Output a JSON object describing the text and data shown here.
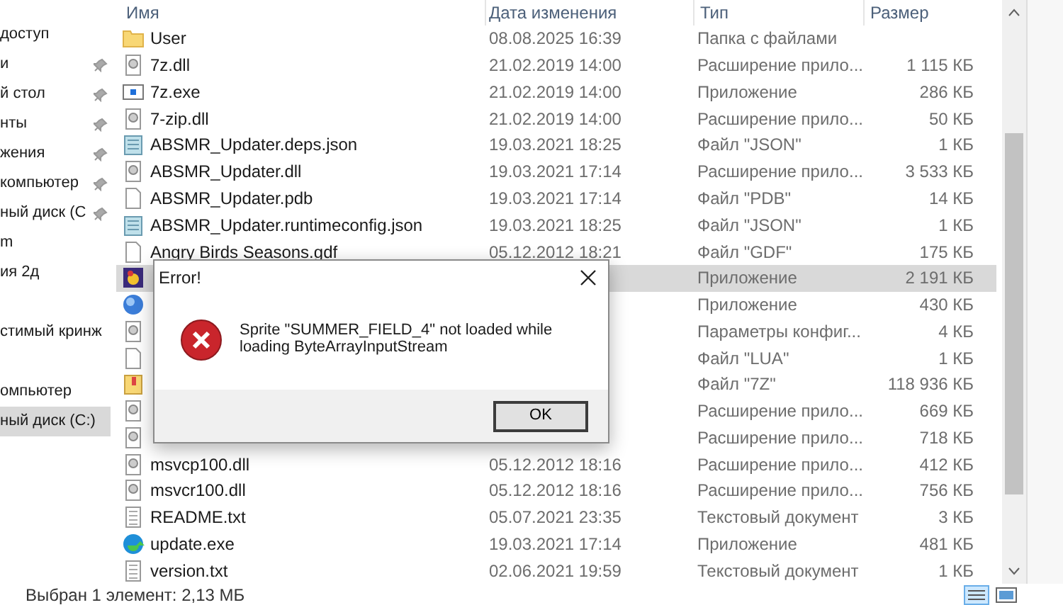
{
  "nav_groups": [
    {
      "items": [
        {
          "label": "доступ",
          "pinned": false,
          "selected": false
        },
        {
          "label": "и",
          "pinned": true,
          "selected": false
        },
        {
          "label": "й стол",
          "pinned": true,
          "selected": false
        },
        {
          "label": "нты",
          "pinned": true,
          "selected": false
        },
        {
          "label": "жения",
          "pinned": true,
          "selected": false
        },
        {
          "label": "компьютер",
          "pinned": true,
          "selected": false
        },
        {
          "label": "ный диск (C",
          "pinned": true,
          "selected": false
        },
        {
          "label": "m",
          "pinned": false,
          "selected": false
        },
        {
          "label": "ия 2д",
          "pinned": false,
          "selected": false
        }
      ]
    },
    {
      "items": [
        {
          "label": "стимый кринж",
          "pinned": false,
          "selected": false
        }
      ]
    },
    {
      "items": [
        {
          "label": "омпьютер",
          "pinned": false,
          "selected": false
        },
        {
          "label": "ный диск (C:)",
          "pinned": false,
          "selected": true
        }
      ]
    }
  ],
  "columns": [
    "Имя",
    "Дата изменения",
    "Тип",
    "Размер"
  ],
  "files": [
    {
      "kind": "folder",
      "name": "User",
      "date": "08.08.2025 16:39",
      "type": "Папка с файлами",
      "selected": false
    },
    {
      "kind": "dll",
      "name": "7z.dll",
      "date": "21.02.2019 14:00",
      "type": "Расширение прило...",
      "size": "1 115 КБ",
      "selected": false
    },
    {
      "kind": "exe",
      "name": "7z.exe",
      "date": "21.02.2019 14:00",
      "type": "Приложение",
      "size": "286 КБ",
      "selected": false
    },
    {
      "kind": "dll",
      "name": "7-zip.dll",
      "date": "21.02.2019 14:00",
      "type": "Расширение прило...",
      "size": "50 КБ",
      "selected": false
    },
    {
      "kind": "json",
      "name": "ABSMR_Updater.deps.json",
      "date": "19.03.2021 18:25",
      "type": "Файл \"JSON\"",
      "size": "1 КБ",
      "selected": false
    },
    {
      "kind": "dll",
      "name": "ABSMR_Updater.dll",
      "date": "19.03.2021 17:14",
      "type": "Расширение прило...",
      "size": "3 533 КБ",
      "selected": false
    },
    {
      "kind": "file",
      "name": "ABSMR_Updater.pdb",
      "date": "19.03.2021 17:14",
      "type": "Файл \"PDB\"",
      "size": "14 КБ",
      "selected": false
    },
    {
      "kind": "json",
      "name": "ABSMR_Updater.runtimeconfig.json",
      "date": "19.03.2021 18:25",
      "type": "Файл \"JSON\"",
      "size": "1 КБ",
      "selected": false
    },
    {
      "kind": "file",
      "name": "Angry Birds Seasons.gdf",
      "date": "05.12.2012 18:21",
      "type": "Файл \"GDF\"",
      "size": "175 КБ",
      "selected": false
    },
    {
      "kind": "game",
      "type": "Приложение",
      "size": "2 191 КБ",
      "selected": true
    },
    {
      "kind": "globe",
      "type": "Приложение",
      "size": "430 КБ",
      "selected": false
    },
    {
      "kind": "dll",
      "type": "Параметры конфиг...",
      "size": "4 КБ",
      "selected": false
    },
    {
      "kind": "file",
      "type": "Файл \"LUA\"",
      "size": "1 КБ",
      "selected": false
    },
    {
      "kind": "archive",
      "type": "Файл \"7Z\"",
      "size": "118 936 КБ",
      "selected": false
    },
    {
      "kind": "dll",
      "type": "Расширение прило...",
      "size": "669 КБ",
      "selected": false
    },
    {
      "kind": "dll",
      "type": "Расширение прило...",
      "size": "718 КБ",
      "selected": false
    },
    {
      "kind": "dll",
      "name": "msvcp100.dll",
      "date": "05.12.2012 18:16",
      "type": "Расширение прило...",
      "size": "412 КБ",
      "selected": false
    },
    {
      "kind": "dll",
      "name": "msvcr100.dll",
      "date": "05.12.2012 18:16",
      "type": "Расширение прило...",
      "size": "756 КБ",
      "selected": false
    },
    {
      "kind": "txt",
      "name": "README.txt",
      "date": "05.07.2021 23:35",
      "type": "Текстовый документ",
      "size": "3 КБ",
      "selected": false
    },
    {
      "kind": "update",
      "name": "update.exe",
      "date": "19.03.2021 17:14",
      "type": "Приложение",
      "size": "481 КБ",
      "selected": false
    },
    {
      "kind": "txt",
      "name": "version.txt",
      "date": "02.06.2021 19:59",
      "type": "Текстовый документ",
      "size": "1 КБ",
      "selected": false
    }
  ],
  "status_bar": "Выбран 1 элемент: 2,13 МБ",
  "dialog": {
    "title": "Error!",
    "message": "Sprite \"SUMMER_FIELD_4\" not loaded while loading ByteArrayInputStream",
    "buttons": [
      "OK"
    ]
  }
}
